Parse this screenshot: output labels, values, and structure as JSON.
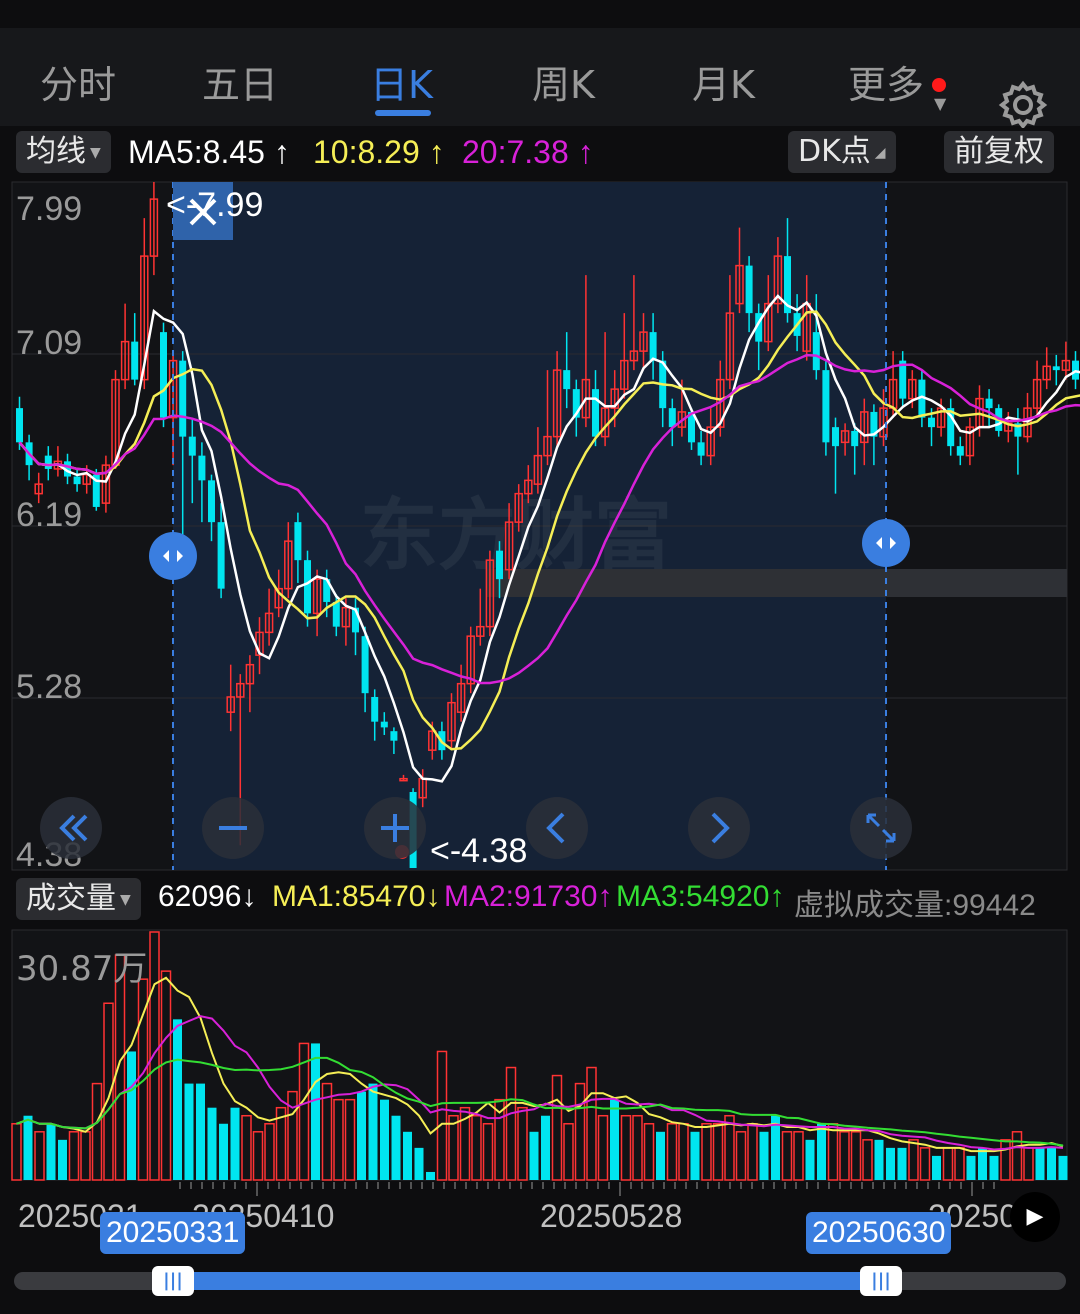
{
  "tabs": [
    {
      "label": "分时",
      "active": false
    },
    {
      "label": "五日",
      "active": false
    },
    {
      "label": "日K",
      "active": true
    },
    {
      "label": "周K",
      "active": false
    },
    {
      "label": "月K",
      "active": false
    },
    {
      "label": "更多",
      "active": false
    }
  ],
  "ma_bar": {
    "selector": "均线",
    "ma5": "MA5:8.45",
    "ma10": "10:8.29",
    "ma20": "20:7.38",
    "arrow_up": "↑",
    "dk_button": "DK点",
    "fq_button": "前复权"
  },
  "colors": {
    "up": "#ff3333",
    "down": "#00e5f0",
    "ma5": "#ffffff",
    "ma10": "#f5ee56",
    "ma20": "#d821d8",
    "accent": "#3a7ee0",
    "vol_ma3": "#33dd33"
  },
  "price_axis": {
    "ticks": [
      "7.99",
      "7.09",
      "6.19",
      "5.28",
      "4.38"
    ]
  },
  "annotations": {
    "high": "<-7.99",
    "low": "<-4.38"
  },
  "watermark": "东方财富",
  "volume_bar": {
    "selector": "成交量",
    "vol": "62096",
    "vol_arrow": "↓",
    "ma1": "MA1:85470",
    "ma1_arrow": "↓",
    "ma2": "MA2:91730",
    "ma2_arrow": "↑",
    "ma3": "MA3:54920",
    "ma3_arrow": "↑",
    "virtual": "虚拟成交量:99442"
  },
  "volume_axis": {
    "max_label": "30.87万"
  },
  "date_axis": {
    "labels": [
      "2025031",
      "20250410",
      "20250528",
      "202507"
    ],
    "range_start": "20250331",
    "range_end": "20250630"
  },
  "icons": {
    "settings": "gear-icon",
    "nav": [
      "double-left-icon",
      "zoom-out-icon",
      "zoom-in-icon",
      "left-icon",
      "right-icon",
      "expand-icon"
    ],
    "play": "play-icon"
  },
  "chart_data": {
    "type": "candlestick",
    "y_range": [
      4.38,
      7.99
    ],
    "volume_max": 30.87,
    "volume_unit": "万",
    "candles": [
      [
        6.8,
        6.62,
        6.86,
        6.58
      ],
      [
        6.62,
        6.5,
        6.66,
        6.42
      ],
      [
        6.35,
        6.4,
        6.46,
        6.3
      ],
      [
        6.55,
        6.48,
        6.6,
        6.42
      ],
      [
        6.48,
        6.52,
        6.6,
        6.44
      ],
      [
        6.52,
        6.44,
        6.56,
        6.4
      ],
      [
        6.44,
        6.4,
        6.48,
        6.36
      ],
      [
        6.4,
        6.45,
        6.5,
        6.35
      ],
      [
        6.45,
        6.28,
        6.48,
        6.26
      ],
      [
        6.3,
        6.5,
        6.55,
        6.25
      ],
      [
        6.5,
        6.95,
        7.0,
        6.48
      ],
      [
        6.95,
        7.15,
        7.35,
        6.9
      ],
      [
        7.15,
        6.95,
        7.3,
        6.92
      ],
      [
        6.95,
        7.6,
        7.8,
        6.9
      ],
      [
        7.6,
        7.9,
        7.99,
        7.5
      ],
      [
        7.2,
        6.75,
        7.25,
        6.7
      ],
      [
        6.75,
        7.05,
        7.1,
        6.5
      ],
      [
        7.05,
        6.65,
        7.1,
        6.1
      ],
      [
        6.65,
        6.55,
        6.75,
        6.3
      ],
      [
        6.55,
        6.42,
        6.62,
        6.2
      ],
      [
        6.42,
        6.2,
        6.45,
        6.1
      ],
      [
        6.2,
        5.85,
        6.3,
        5.8
      ],
      [
        5.2,
        5.28,
        5.45,
        5.1
      ],
      [
        5.28,
        5.35,
        5.4,
        4.5
      ],
      [
        5.35,
        5.45,
        5.5,
        5.2
      ],
      [
        5.5,
        5.62,
        5.7,
        5.4
      ],
      [
        5.62,
        5.72,
        5.85,
        5.55
      ],
      [
        5.75,
        5.85,
        5.95,
        5.7
      ],
      [
        5.85,
        6.1,
        6.2,
        5.8
      ],
      [
        6.2,
        6.0,
        6.25,
        5.88
      ],
      [
        6.0,
        5.72,
        6.05,
        5.65
      ],
      [
        5.72,
        5.9,
        5.95,
        5.6
      ],
      [
        5.9,
        5.78,
        5.95,
        5.7
      ],
      [
        5.78,
        5.65,
        5.82,
        5.6
      ],
      [
        5.65,
        5.75,
        5.8,
        5.55
      ],
      [
        5.75,
        5.62,
        5.8,
        5.5
      ],
      [
        5.6,
        5.3,
        5.65,
        5.2
      ],
      [
        5.28,
        5.15,
        5.32,
        5.05
      ],
      [
        5.15,
        5.12,
        5.2,
        5.08
      ],
      [
        5.1,
        5.05,
        5.12,
        4.98
      ],
      [
        4.85,
        4.85,
        4.87,
        4.84
      ],
      [
        4.78,
        4.38,
        4.8,
        4.38
      ],
      [
        4.75,
        4.85,
        4.9,
        4.7
      ],
      [
        5.0,
        5.1,
        5.15,
        4.95
      ],
      [
        5.1,
        5.0,
        5.15,
        4.95
      ],
      [
        5.05,
        5.25,
        5.3,
        5.0
      ],
      [
        5.2,
        5.35,
        5.45,
        5.15
      ],
      [
        5.35,
        5.6,
        5.65,
        5.3
      ],
      [
        5.6,
        5.65,
        5.85,
        5.55
      ],
      [
        5.65,
        6.0,
        6.05,
        5.6
      ],
      [
        6.05,
        5.9,
        6.1,
        5.8
      ],
      [
        5.95,
        6.2,
        6.3,
        5.9
      ],
      [
        6.2,
        6.35,
        6.4,
        6.15
      ],
      [
        6.35,
        6.42,
        6.5,
        6.3
      ],
      [
        6.4,
        6.55,
        6.7,
        6.35
      ],
      [
        6.55,
        6.65,
        7.0,
        6.5
      ],
      [
        6.65,
        7.0,
        7.1,
        6.6
      ],
      [
        7.0,
        6.9,
        7.2,
        6.8
      ],
      [
        6.9,
        6.75,
        6.95,
        6.65
      ],
      [
        6.75,
        6.95,
        7.5,
        6.7
      ],
      [
        6.9,
        6.65,
        7.0,
        6.6
      ],
      [
        6.65,
        6.8,
        7.2,
        6.6
      ],
      [
        6.8,
        6.9,
        7.0,
        6.7
      ],
      [
        6.9,
        7.05,
        7.3,
        6.85
      ],
      [
        7.05,
        7.1,
        7.5,
        7.0
      ],
      [
        7.1,
        7.2,
        7.3,
        7.0
      ],
      [
        7.2,
        7.05,
        7.3,
        6.95
      ],
      [
        7.05,
        6.8,
        7.1,
        6.7
      ],
      [
        6.8,
        6.7,
        6.85,
        6.6
      ],
      [
        6.7,
        6.78,
        6.95,
        6.65
      ],
      [
        6.78,
        6.62,
        6.8,
        6.58
      ],
      [
        6.62,
        6.55,
        6.68,
        6.5
      ],
      [
        6.55,
        6.7,
        6.8,
        6.5
      ],
      [
        6.7,
        6.95,
        7.05,
        6.65
      ],
      [
        6.95,
        7.3,
        7.5,
        6.9
      ],
      [
        7.35,
        7.55,
        7.75,
        7.3
      ],
      [
        7.55,
        7.3,
        7.6,
        7.2
      ],
      [
        7.3,
        7.15,
        7.35,
        7.0
      ],
      [
        7.15,
        7.35,
        7.5,
        7.1
      ],
      [
        7.35,
        7.6,
        7.7,
        7.3
      ],
      [
        7.6,
        7.3,
        7.8,
        7.25
      ],
      [
        7.3,
        7.18,
        7.4,
        7.1
      ],
      [
        7.1,
        7.35,
        7.5,
        7.05
      ],
      [
        7.2,
        7.0,
        7.4,
        6.95
      ],
      [
        7.0,
        6.62,
        7.05,
        6.55
      ],
      [
        6.7,
        6.6,
        6.75,
        6.35
      ],
      [
        6.62,
        6.68,
        6.72,
        6.55
      ],
      [
        6.68,
        6.6,
        6.72,
        6.45
      ],
      [
        6.62,
        6.78,
        6.85,
        6.5
      ],
      [
        6.78,
        6.65,
        6.82,
        6.5
      ],
      [
        6.65,
        6.8,
        6.9,
        6.6
      ],
      [
        6.8,
        6.95,
        7.1,
        6.75
      ],
      [
        7.05,
        6.85,
        7.1,
        6.8
      ],
      [
        6.85,
        6.95,
        7.0,
        6.8
      ],
      [
        6.95,
        6.75,
        7.0,
        6.7
      ],
      [
        6.75,
        6.7,
        6.8,
        6.6
      ],
      [
        6.7,
        6.8,
        6.85,
        6.65
      ],
      [
        6.8,
        6.6,
        6.85,
        6.55
      ],
      [
        6.6,
        6.55,
        6.65,
        6.5
      ],
      [
        6.55,
        6.7,
        6.75,
        6.5
      ],
      [
        6.7,
        6.85,
        6.92,
        6.65
      ],
      [
        6.85,
        6.8,
        6.9,
        6.7
      ],
      [
        6.8,
        6.68,
        6.82,
        6.65
      ],
      [
        6.68,
        6.72,
        6.78,
        6.62
      ],
      [
        6.72,
        6.65,
        6.8,
        6.45
      ],
      [
        6.65,
        6.8,
        6.88,
        6.62
      ],
      [
        6.8,
        6.95,
        7.05,
        6.75
      ],
      [
        6.95,
        7.02,
        7.12,
        6.9
      ],
      [
        7.02,
        7.0,
        7.08,
        6.92
      ],
      [
        7.0,
        7.05,
        7.15,
        6.95
      ],
      [
        7.05,
        6.95,
        7.1,
        6.9
      ],
      [
        6.95,
        6.9,
        7.05,
        6.85
      ],
      [
        6.9,
        6.92,
        7.0,
        6.8
      ]
    ],
    "volumes": [
      [
        7,
        "u"
      ],
      [
        8,
        "d"
      ],
      [
        6,
        "u"
      ],
      [
        7,
        "d"
      ],
      [
        5,
        "d"
      ],
      [
        6,
        "u"
      ],
      [
        6,
        "u"
      ],
      [
        12,
        "u"
      ],
      [
        22,
        "u"
      ],
      [
        28,
        "u"
      ],
      [
        16,
        "d"
      ],
      [
        25,
        "u"
      ],
      [
        30.87,
        "u"
      ],
      [
        26,
        "u"
      ],
      [
        20,
        "d"
      ],
      [
        12,
        "d"
      ],
      [
        12,
        "d"
      ],
      [
        9,
        "d"
      ],
      [
        7,
        "d"
      ],
      [
        9,
        "d"
      ],
      [
        8,
        "u"
      ],
      [
        6,
        "u"
      ],
      [
        7,
        "u"
      ],
      [
        9,
        "u"
      ],
      [
        11,
        "u"
      ],
      [
        17,
        "u"
      ],
      [
        17,
        "d"
      ],
      [
        12,
        "u"
      ],
      [
        10,
        "u"
      ],
      [
        10,
        "u"
      ],
      [
        11,
        "d"
      ],
      [
        12,
        "d"
      ],
      [
        10,
        "d"
      ],
      [
        8,
        "d"
      ],
      [
        6,
        "d"
      ],
      [
        4,
        "d"
      ],
      [
        1,
        "d"
      ],
      [
        16,
        "u"
      ],
      [
        8,
        "u"
      ],
      [
        9,
        "u"
      ],
      [
        8,
        "u"
      ],
      [
        7,
        "u"
      ],
      [
        10,
        "u"
      ],
      [
        14,
        "u"
      ],
      [
        9,
        "u"
      ],
      [
        6,
        "d"
      ],
      [
        8,
        "d"
      ],
      [
        13,
        "u"
      ],
      [
        7,
        "u"
      ],
      [
        12,
        "u"
      ],
      [
        14,
        "u"
      ],
      [
        8,
        "u"
      ],
      [
        10,
        "d"
      ],
      [
        8,
        "u"
      ],
      [
        8,
        "u"
      ],
      [
        7,
        "u"
      ],
      [
        6,
        "d"
      ],
      [
        7,
        "u"
      ],
      [
        7,
        "u"
      ],
      [
        6,
        "d"
      ],
      [
        7,
        "u"
      ],
      [
        7,
        "u"
      ],
      [
        8,
        "u"
      ],
      [
        6,
        "u"
      ],
      [
        7,
        "u"
      ],
      [
        6,
        "d"
      ],
      [
        8,
        "d"
      ],
      [
        6,
        "u"
      ],
      [
        6,
        "u"
      ],
      [
        5,
        "d"
      ],
      [
        7,
        "d"
      ],
      [
        7,
        "u"
      ],
      [
        6,
        "u"
      ],
      [
        6,
        "u"
      ],
      [
        5,
        "u"
      ],
      [
        5,
        "d"
      ],
      [
        4,
        "d"
      ],
      [
        4,
        "d"
      ],
      [
        5,
        "u"
      ],
      [
        4,
        "u"
      ],
      [
        3,
        "d"
      ],
      [
        4,
        "u"
      ],
      [
        4,
        "u"
      ],
      [
        3,
        "d"
      ],
      [
        4,
        "d"
      ],
      [
        3,
        "d"
      ],
      [
        5,
        "u"
      ],
      [
        6,
        "u"
      ],
      [
        4,
        "u"
      ],
      [
        4,
        "d"
      ],
      [
        4,
        "d"
      ],
      [
        3,
        "d"
      ]
    ]
  }
}
